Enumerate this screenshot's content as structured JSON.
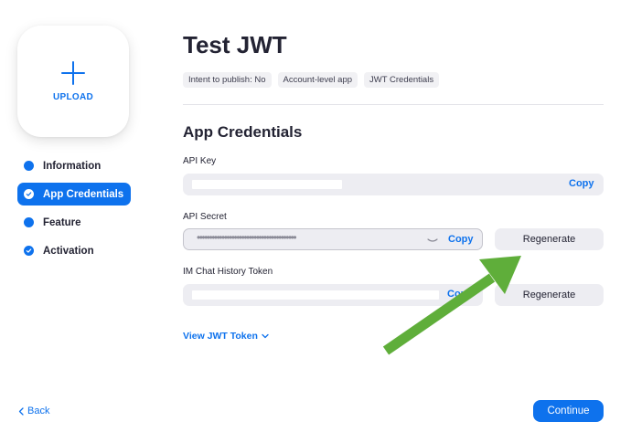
{
  "sidebar": {
    "upload_label": "UPLOAD",
    "items": [
      {
        "label": "Information",
        "state": "dot"
      },
      {
        "label": "App Credentials",
        "state": "active-check"
      },
      {
        "label": "Feature",
        "state": "dot"
      },
      {
        "label": "Activation",
        "state": "check"
      }
    ]
  },
  "header": {
    "title": "Test JWT",
    "tags": [
      "Intent to publish: No",
      "Account-level app",
      "JWT Credentials"
    ]
  },
  "credentials": {
    "section_title": "App Credentials",
    "api_key": {
      "label": "API Key",
      "copy": "Copy"
    },
    "api_secret": {
      "label": "API Secret",
      "masked_value": "••••••••••••••••••••••••••••••••••••••••",
      "copy": "Copy",
      "regenerate": "Regenerate"
    },
    "im_token": {
      "label": "IM Chat History Token",
      "copy": "Copy",
      "regenerate": "Regenerate"
    },
    "view_jwt": "View JWT Token"
  },
  "footer": {
    "back": "Back",
    "continue": "Continue"
  },
  "colors": {
    "accent": "#0e72ed",
    "annotation_arrow": "#5fae3a"
  }
}
